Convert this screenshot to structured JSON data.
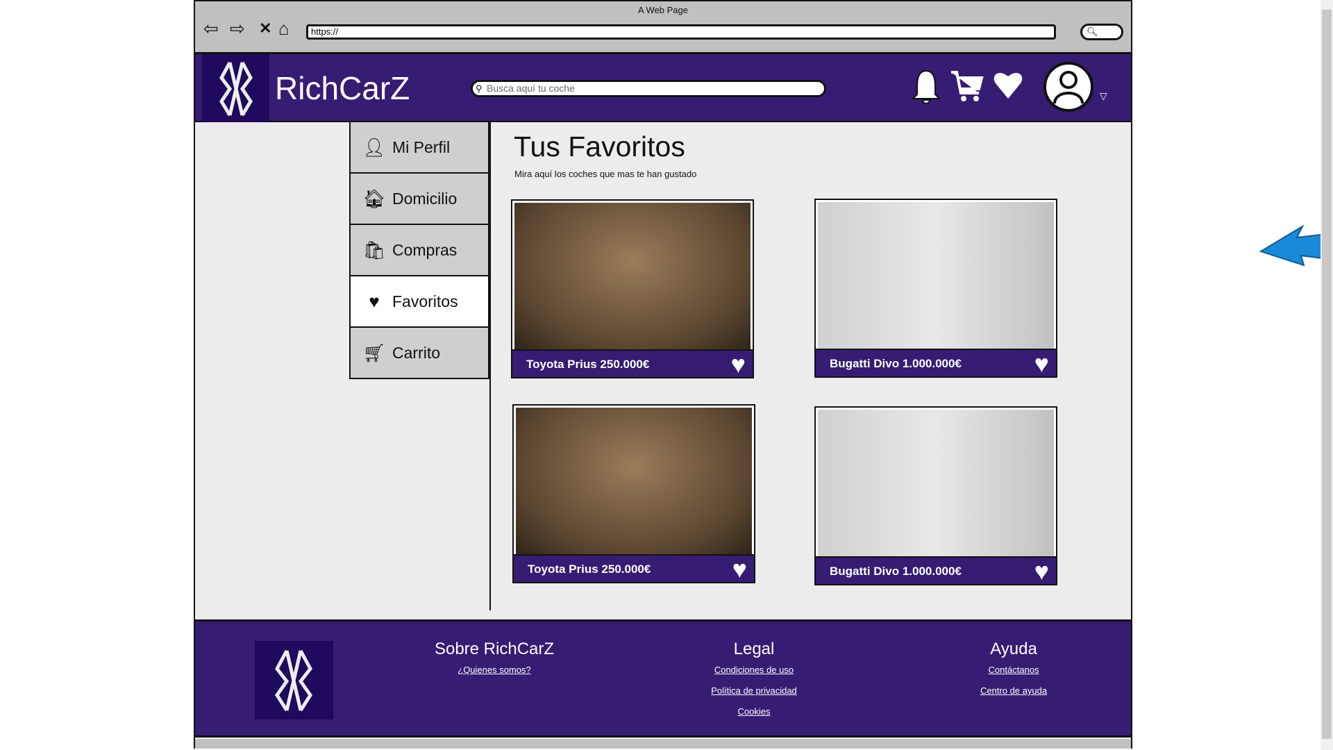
{
  "browser": {
    "title": "A Web Page",
    "url": "https://",
    "nav_icons": [
      "back-arrow",
      "forward-arrow",
      "close-x",
      "home"
    ]
  },
  "header": {
    "brand": "RichCarZ",
    "search_placeholder": "Busca aquí tu coche",
    "icons": [
      "bell-icon",
      "cart-icon",
      "heart-icon",
      "user-avatar-icon"
    ]
  },
  "sidebar": {
    "items": [
      {
        "label": "Mi Perfil",
        "icon": "user-icon"
      },
      {
        "label": "Domicilio",
        "icon": "home-icon"
      },
      {
        "label": "Compras",
        "icon": "bag-icon"
      },
      {
        "label": "Favoritos",
        "icon": "heart-icon",
        "active": true
      },
      {
        "label": "Carrito",
        "icon": "cart-icon"
      }
    ]
  },
  "main": {
    "title": "Tus Favoritos",
    "subtitle": "Mira aquí los coches que mas te han gustado",
    "cards": [
      {
        "caption": "Toyota Prius 250.000€",
        "color": "yellow"
      },
      {
        "caption": "Bugatti Divo 1.000.000€",
        "color": "red"
      },
      {
        "caption": "Toyota Prius 250.000€",
        "color": "yellow"
      },
      {
        "caption": "Bugatti Divo 1.000.000€",
        "color": "red"
      }
    ]
  },
  "footer": {
    "columns": [
      {
        "heading": "Sobre RichCarZ",
        "links": [
          "¿Quienes somos?"
        ]
      },
      {
        "heading": "Legal",
        "links": [
          "Condiciones de uso",
          "Política de privacidad",
          "Cookies"
        ]
      },
      {
        "heading": "Ayuda",
        "links": [
          "Contáctanos",
          "Centro de ayuda"
        ]
      }
    ]
  },
  "colors": {
    "brand": "#361c73",
    "logo_bg": "#1f0a5e"
  }
}
